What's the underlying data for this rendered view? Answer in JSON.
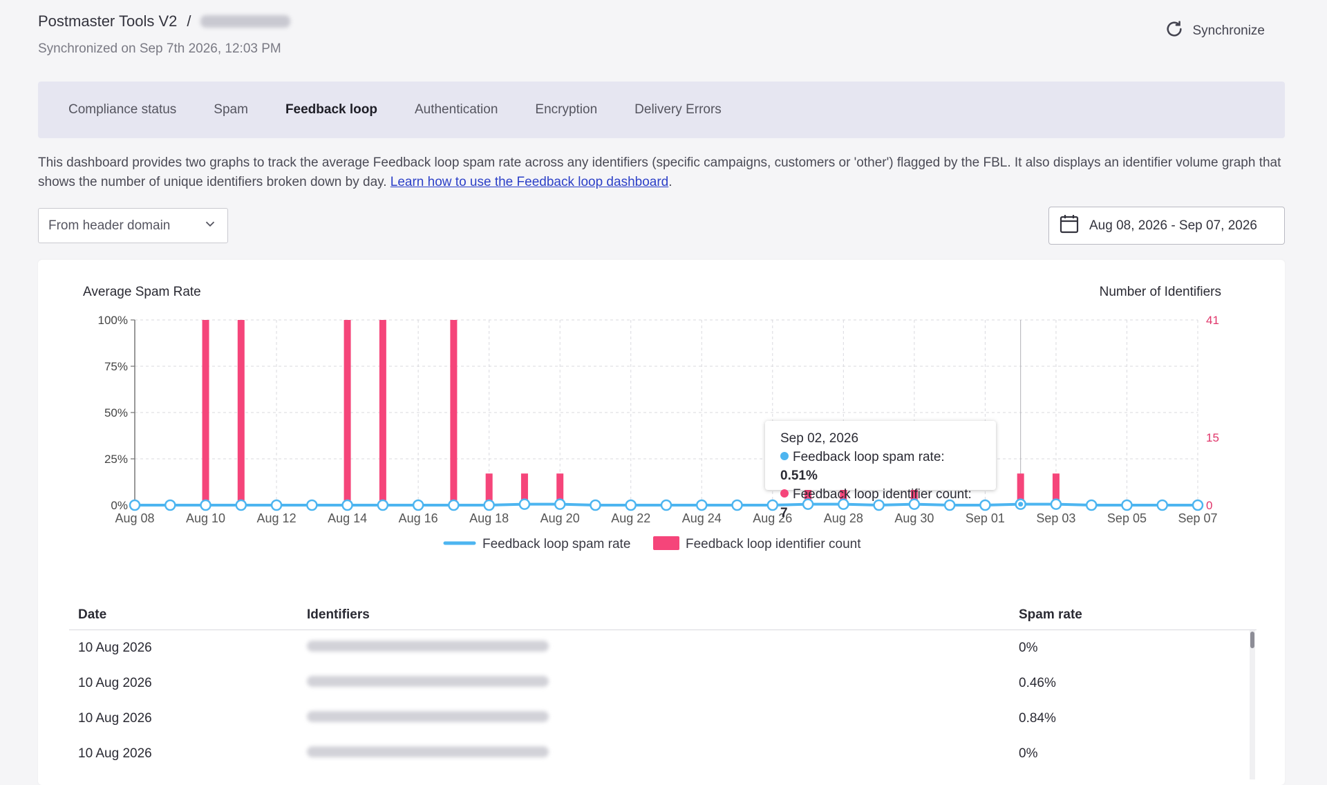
{
  "header": {
    "app_title": "Postmaster Tools V2",
    "breadcrumb_sep": "/",
    "sync_status": "Synchronized on Sep 7th 2026, 12:03 PM",
    "sync_button": "Synchronize"
  },
  "tabs": [
    {
      "label": "Compliance status",
      "active": false
    },
    {
      "label": "Spam",
      "active": false
    },
    {
      "label": "Feedback loop",
      "active": true
    },
    {
      "label": "Authentication",
      "active": false
    },
    {
      "label": "Encryption",
      "active": false
    },
    {
      "label": "Delivery Errors",
      "active": false
    }
  ],
  "description": {
    "text": "This dashboard provides two graphs to track the average Feedback loop spam rate across any identifiers (specific campaigns, customers or 'other') flagged by the FBL. It also displays an identifier volume graph that shows the number of unique identifiers broken down by day. ",
    "link": "Learn how to use the Feedback loop dashboard",
    "period": "."
  },
  "filter": {
    "selected": "From header domain",
    "icon": "chevron-down-icon"
  },
  "daterange": {
    "label": "Aug 08, 2026 - Sep 07, 2026",
    "icon": "calendar-icon"
  },
  "chart_data": {
    "type": "bar",
    "title_left": "Average Spam Rate",
    "title_right": "Number of Identifiers",
    "x": [
      "Aug 08",
      "Aug 09",
      "Aug 10",
      "Aug 11",
      "Aug 12",
      "Aug 13",
      "Aug 14",
      "Aug 15",
      "Aug 16",
      "Aug 17",
      "Aug 18",
      "Aug 19",
      "Aug 20",
      "Aug 21",
      "Aug 22",
      "Aug 23",
      "Aug 24",
      "Aug 25",
      "Aug 26",
      "Aug 27",
      "Aug 28",
      "Aug 29",
      "Aug 30",
      "Aug 31",
      "Sep 01",
      "Sep 02",
      "Sep 03",
      "Sep 04",
      "Sep 05",
      "Sep 06",
      "Sep 07"
    ],
    "x_tick_labels": [
      "Aug 08",
      "Aug 10",
      "Aug 12",
      "Aug 14",
      "Aug 16",
      "Aug 18",
      "Aug 20",
      "Aug 22",
      "Aug 24",
      "Aug 26",
      "Aug 28",
      "Aug 30",
      "Sep 01",
      "Sep 03",
      "Sep 05",
      "Sep 07"
    ],
    "left_ticks": [
      "0%",
      "25%",
      "50%",
      "75%",
      "100%"
    ],
    "right_ticks": [
      "0",
      "15",
      "41"
    ],
    "left_ylim": [
      0,
      100
    ],
    "right_ylim": [
      0,
      41
    ],
    "series": [
      {
        "name": "Feedback loop spam rate",
        "kind": "line",
        "axis": "left",
        "color": "#4db5f0",
        "values": [
          0,
          0,
          0,
          0,
          0,
          0,
          0,
          0,
          0,
          0,
          0,
          0.5,
          0.5,
          0,
          0,
          0,
          0,
          0,
          0,
          0.5,
          0.5,
          0,
          0.5,
          0,
          0,
          0.51,
          0.5,
          0,
          0,
          0,
          0
        ]
      },
      {
        "name": "Feedback loop identifier count",
        "kind": "bar",
        "axis": "right",
        "color": "#f5457a",
        "values": [
          0,
          0,
          41,
          41,
          0,
          0,
          41,
          41,
          0,
          41,
          7,
          7,
          7,
          0,
          0,
          0,
          0,
          0,
          0,
          7,
          7,
          0,
          7,
          0,
          0,
          7,
          7,
          0,
          0,
          0,
          0
        ]
      }
    ],
    "grid": true,
    "legend": "bottom-center"
  },
  "tooltip": {
    "date": "Sep 02, 2026",
    "rate_label": "Feedback loop spam rate: ",
    "rate_value": "0.51%",
    "count_label": "Feedback loop identifier count: ",
    "count_value": "7"
  },
  "table": {
    "columns": [
      "Date",
      "Identifiers",
      "Spam rate"
    ],
    "rows": [
      {
        "date": "10 Aug 2026",
        "rate": "0%"
      },
      {
        "date": "10 Aug 2026",
        "rate": "0.46%"
      },
      {
        "date": "10 Aug 2026",
        "rate": "0.84%"
      },
      {
        "date": "10 Aug 2026",
        "rate": "0%"
      }
    ]
  }
}
